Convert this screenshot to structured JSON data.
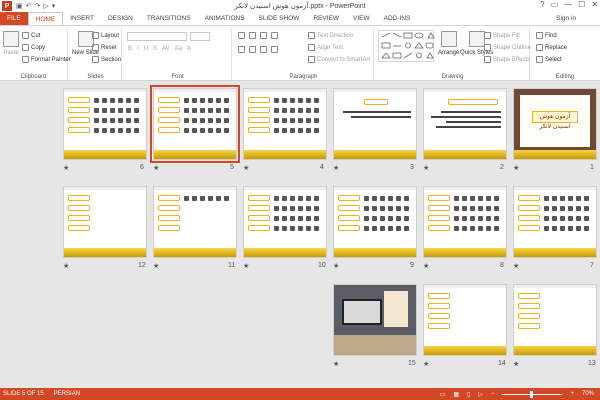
{
  "window": {
    "title": "آزمون هوش اسنیدن لانکر.pptx - PowerPoint",
    "app_logo": "P",
    "quick_access": [
      "save-icon",
      "undo-icon",
      "redo-icon",
      "slideshow-icon",
      "customize-icon"
    ],
    "controls": {
      "help": "?",
      "restore": "▭",
      "minimize": "—",
      "maximize": "☐",
      "close": "✕"
    }
  },
  "tabs": [
    {
      "label": "FILE"
    },
    {
      "label": "HOME"
    },
    {
      "label": "INSERT"
    },
    {
      "label": "DESIGN"
    },
    {
      "label": "TRANSITIONS"
    },
    {
      "label": "ANIMATIONS"
    },
    {
      "label": "SLIDE SHOW"
    },
    {
      "label": "REVIEW"
    },
    {
      "label": "VIEW"
    },
    {
      "label": "ADD-INS"
    }
  ],
  "signin": "Sign in",
  "ribbon": {
    "clipboard": {
      "label": "Clipboard",
      "paste": "Paste",
      "cut": "Cut",
      "copy": "Copy",
      "format_painter": "Format Painter"
    },
    "slides": {
      "label": "Slides",
      "new_slide": "New Slide",
      "layout": "Layout",
      "reset": "Reset",
      "section": "Section"
    },
    "font": {
      "label": "Font"
    },
    "paragraph": {
      "label": "Paragraph",
      "text_direction": "Text Direction",
      "align_text": "Align Text",
      "convert": "Convert to SmartArt"
    },
    "drawing": {
      "label": "Drawing",
      "arrange": "Arrange",
      "quick_styles": "Quick Styles",
      "shape_fill": "Shape Fill",
      "shape_outline": "Shape Outline",
      "shape_effects": "Shape Effects"
    },
    "editing": {
      "label": "Editing",
      "find": "Find",
      "replace": "Replace",
      "select": "Select"
    }
  },
  "slides": [
    {
      "n": "1"
    },
    {
      "n": "2"
    },
    {
      "n": "3"
    },
    {
      "n": "4"
    },
    {
      "n": "5"
    },
    {
      "n": "6"
    },
    {
      "n": "7"
    },
    {
      "n": "8"
    },
    {
      "n": "9"
    },
    {
      "n": "10"
    },
    {
      "n": "11"
    },
    {
      "n": "12"
    },
    {
      "n": "13"
    },
    {
      "n": "14"
    },
    {
      "n": "15"
    }
  ],
  "slide_title_text": "آزمون هوش اسنیدن لانکر",
  "status": {
    "slide_info": "SLIDE 5 OF 15",
    "language": "PERSIAN",
    "zoom": "70%"
  },
  "colors": {
    "accent": "#d24726",
    "band": "#e3b41c"
  }
}
